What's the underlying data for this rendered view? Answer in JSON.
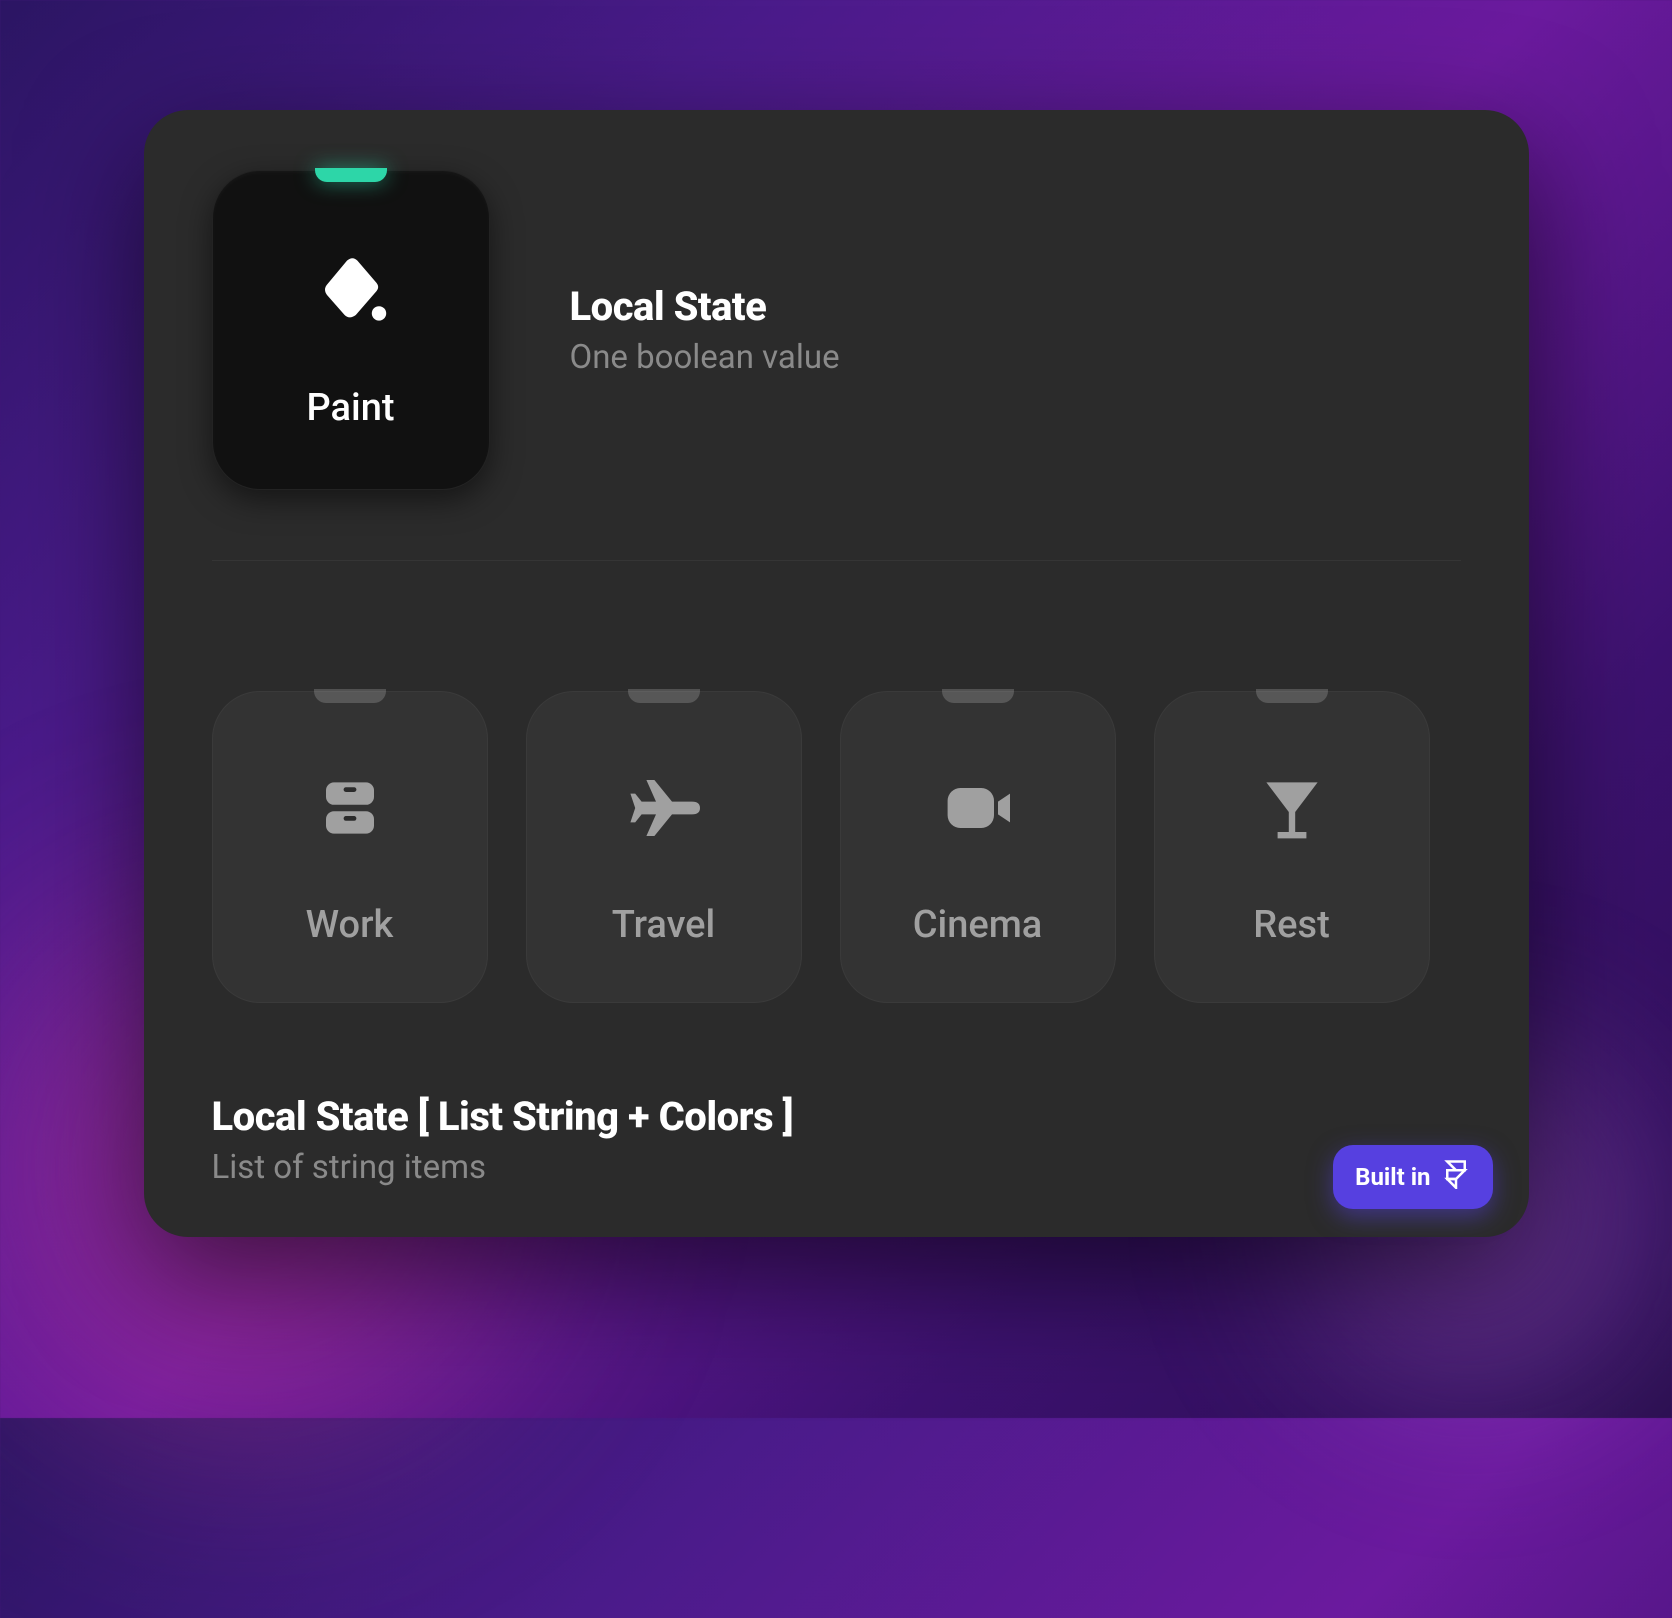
{
  "section1": {
    "title": "Local State",
    "subtitle": "One boolean value",
    "tile": {
      "label": "Paint",
      "icon": "paint-bucket-icon",
      "active": true
    }
  },
  "section2": {
    "title": "Local State [ List String + Colors ]",
    "subtitle": "List of string items",
    "tiles": [
      {
        "label": "Work",
        "icon": "archive-icon"
      },
      {
        "label": "Travel",
        "icon": "plane-icon"
      },
      {
        "label": "Cinema",
        "icon": "video-camera-icon"
      },
      {
        "label": "Rest",
        "icon": "cocktail-icon"
      }
    ]
  },
  "badge": {
    "label": "Built in",
    "icon": "framer-icon"
  },
  "colors": {
    "accent_active": "#2dd6a8",
    "badge_bg": "#5640e0",
    "panel_bg": "#2b2b2b"
  }
}
